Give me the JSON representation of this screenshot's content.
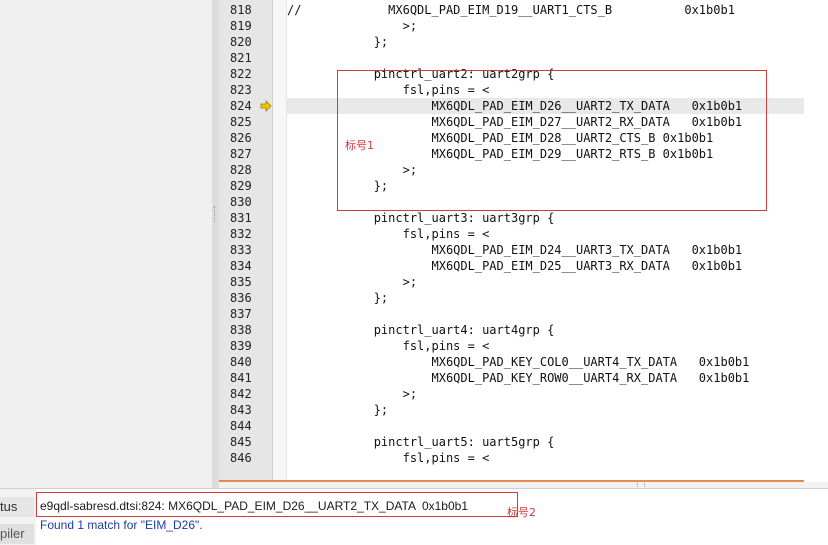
{
  "gutter": {
    "line_numbers": [
      "818",
      "819",
      "820",
      "821",
      "822",
      "823",
      "824",
      "825",
      "826",
      "827",
      "828",
      "829",
      "830",
      "831",
      "832",
      "833",
      "834",
      "835",
      "836",
      "837",
      "838",
      "839",
      "840",
      "841",
      "842",
      "843",
      "844",
      "845",
      "846"
    ],
    "current_line_marker": "824"
  },
  "code": {
    "lines": [
      "//            MX6QDL_PAD_EIM_D19__UART1_CTS_B          0x1b0b1",
      "                >;",
      "            };",
      "",
      "            pinctrl_uart2: uart2grp {",
      "                fsl,pins = <",
      "                    MX6QDL_PAD_EIM_D26__UART2_TX_DATA   0x1b0b1",
      "                    MX6QDL_PAD_EIM_D27__UART2_RX_DATA   0x1b0b1",
      "                    MX6QDL_PAD_EIM_D28__UART2_CTS_B 0x1b0b1",
      "                    MX6QDL_PAD_EIM_D29__UART2_RTS_B 0x1b0b1",
      "                >;",
      "            };",
      "",
      "            pinctrl_uart3: uart3grp {",
      "                fsl,pins = <",
      "                    MX6QDL_PAD_EIM_D24__UART3_TX_DATA   0x1b0b1",
      "                    MX6QDL_PAD_EIM_D25__UART3_RX_DATA   0x1b0b1",
      "                >;",
      "            };",
      "",
      "            pinctrl_uart4: uart4grp {",
      "                fsl,pins = <",
      "                    MX6QDL_PAD_KEY_COL0__UART4_TX_DATA   0x1b0b1",
      "                    MX6QDL_PAD_KEY_ROW0__UART4_RX_DATA   0x1b0b1",
      "                >;",
      "            };",
      "",
      "            pinctrl_uart5: uart5grp {",
      "                fsl,pins = <"
    ],
    "current_line_index": 6
  },
  "annotations": {
    "label1": "标号1",
    "label2": "标号2"
  },
  "bottom_panel": {
    "tab_status": "tus",
    "tab_compiler": "piler",
    "status_message": "e9qdl-sabresd.dtsi:824: MX6QDL_PAD_EIM_D26__UART2_TX_DATA  0x1b0b1",
    "search_message": "Found 1 match for \"EIM_D26\"."
  },
  "colors": {
    "annotation_red": "#d13c3c",
    "accent_orange": "#e58a50",
    "marker_yellow": "#f5c400",
    "link_blue": "#1c3d9e"
  },
  "icons": {
    "current_line_marker": "arrow-right-icon"
  }
}
